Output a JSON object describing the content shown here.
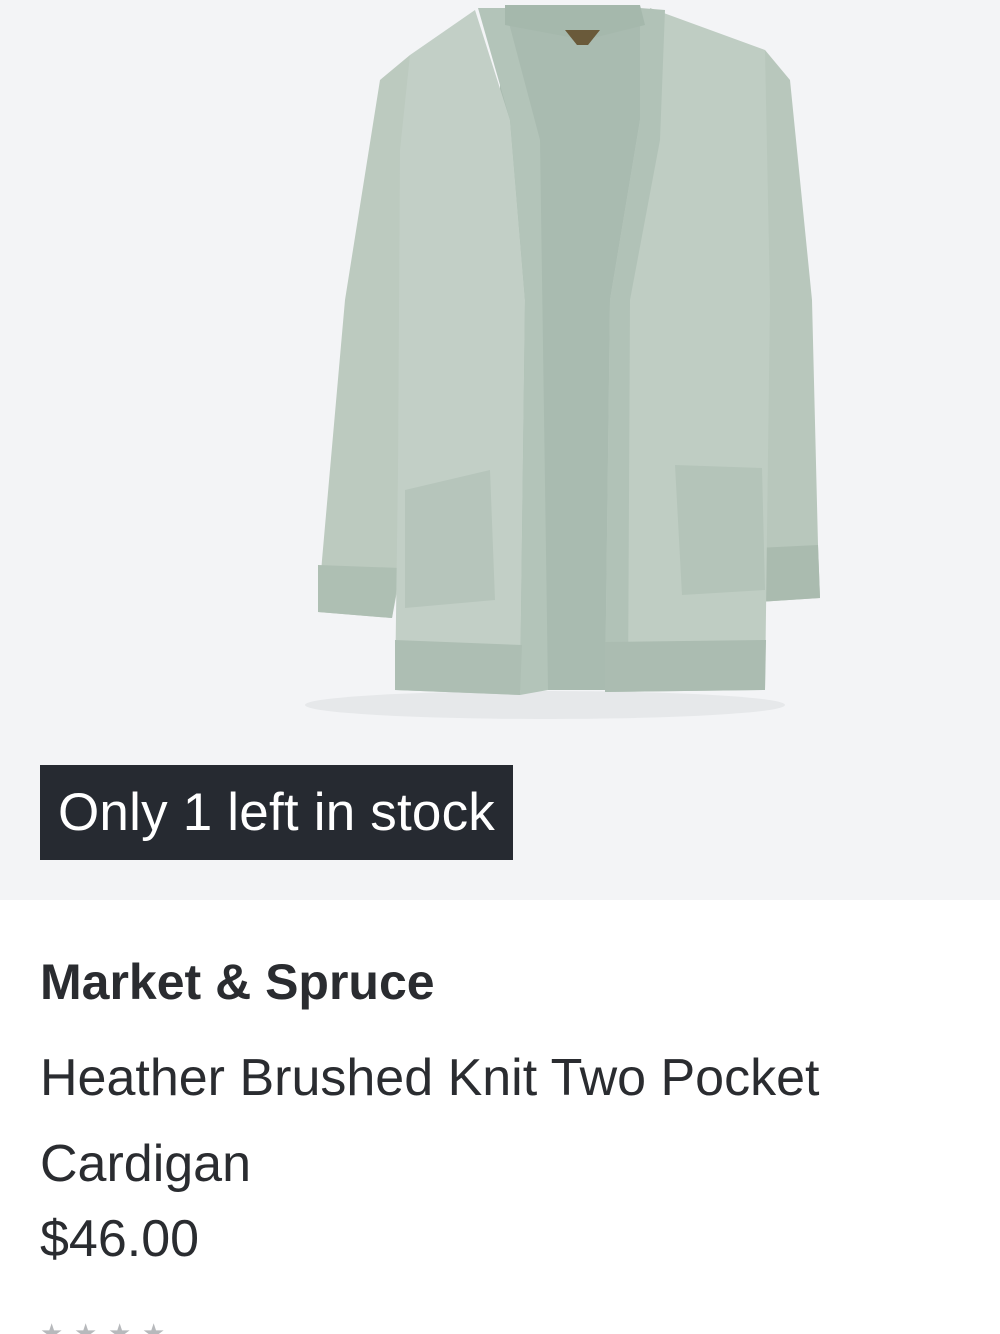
{
  "product": {
    "stock_badge": "Only 1 left in stock",
    "brand": "Market & Spruce",
    "name": "Heather Brushed Knit Two Pocket Cardigan",
    "price": "$46.00",
    "image_icon": "cardigan-image",
    "colors": {
      "badge_bg": "#262a31",
      "media_bg": "#f3f4f6",
      "garment": "#b9c8bf"
    }
  }
}
